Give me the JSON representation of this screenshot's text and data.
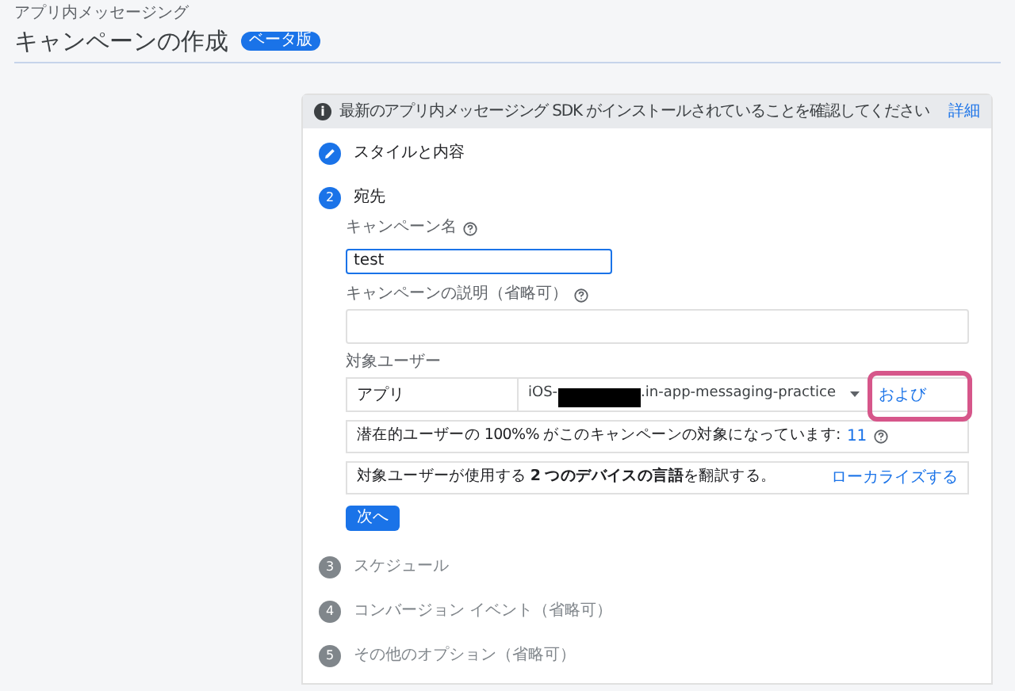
{
  "breadcrumb": "アプリ内メッセージング",
  "title": "キャンペーンの作成",
  "badge": "ベータ版",
  "notice": {
    "icon": "i",
    "text": "最新のアプリ内メッセージング SDK がインストールされていることを確認してください",
    "link": "詳細"
  },
  "steps": [
    {
      "kind": "done",
      "label": "スタイルと内容"
    },
    {
      "kind": "active",
      "number": "2",
      "label": "宛先"
    },
    {
      "kind": "todo",
      "number": "3",
      "label": "スケジュール"
    },
    {
      "kind": "todo",
      "number": "4",
      "label": "コンバージョン イベント（省略可）"
    },
    {
      "kind": "todo",
      "number": "5",
      "label": "その他のオプション（省略可）"
    }
  ],
  "form": {
    "name_label": "キャンペーン名",
    "name_value": "test",
    "description_label": "キャンペーンの説明（省略可）",
    "target_label": "対象ユーザー",
    "target_row": {
      "column": "アプリ",
      "app_prefix": "iOS-",
      "app_suffix": ".in-app-messaging-practice",
      "and_link": "および",
      "highlighted": true
    },
    "reach_text": "潜在的ユーザーの 100%% がこのキャンペーンの対象になっています: ",
    "reach_count": "11",
    "localize_text": "対象ユーザーが使用する **2 つのデバイスの言語**を翻訳する。",
    "localize_link": "ローカライズする",
    "next_button": "次へ"
  }
}
